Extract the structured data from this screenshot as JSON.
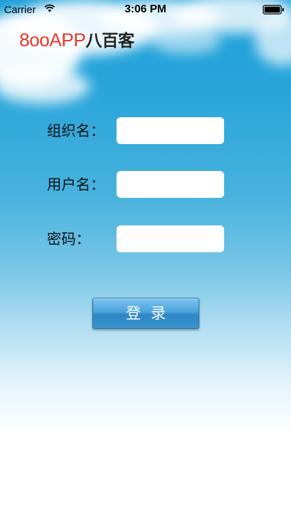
{
  "status_bar": {
    "carrier": "Carrier",
    "time": "3:06 PM"
  },
  "logo": {
    "latin": "8ooAPP",
    "chinese": "八百客",
    "latin_color": "#e8362a"
  },
  "form": {
    "organization_label": "组织名：",
    "organization_value": "",
    "username_label": "用户名：",
    "username_value": "",
    "password_label": "密码：",
    "password_value": ""
  },
  "login_button": {
    "label": "登录"
  },
  "icons": {
    "wifi": "wifi-icon",
    "battery": "battery-icon"
  }
}
